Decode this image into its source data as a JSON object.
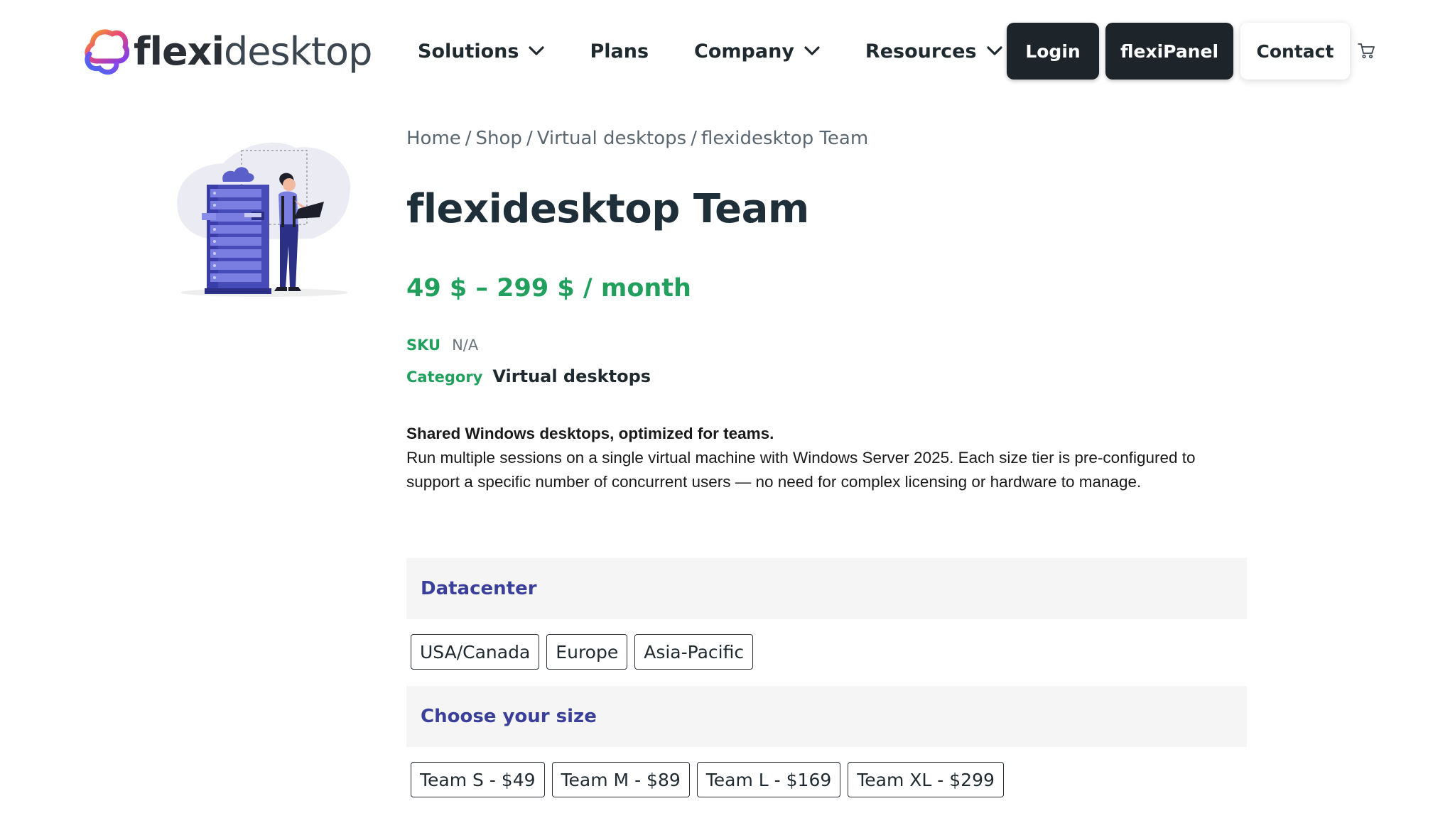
{
  "brand": {
    "logo_icon": "cloud-logo-icon",
    "name_bold": "flexi",
    "name_light": "desktop"
  },
  "nav": {
    "items": [
      {
        "label": "Solutions",
        "dropdown": true
      },
      {
        "label": "Plans",
        "dropdown": false
      },
      {
        "label": "Company",
        "dropdown": true
      },
      {
        "label": "Resources",
        "dropdown": true
      }
    ],
    "login": "Login",
    "panel": "flexiPanel",
    "contact": "Contact",
    "cart_icon": "cart-icon"
  },
  "breadcrumb": [
    "Home",
    "Shop",
    "Virtual desktops",
    "flexidesktop Team"
  ],
  "product": {
    "title": "flexidesktop Team",
    "price": "49 $ – 299 $ / month",
    "sku_label": "SKU",
    "sku_value": "N/A",
    "category_label": "Category",
    "category_value": "Virtual desktops",
    "desc_heading": "Shared Windows desktops, optimized for teams.",
    "desc_body": "Run multiple sessions on a single virtual machine with Windows Server 2025. Each size tier is pre-configured to support a specific number of concurrent users — no need for complex licensing or hardware to manage."
  },
  "datacenter": {
    "title": "Datacenter",
    "options": [
      "USA/Canada",
      "Europe",
      "Asia-Pacific"
    ]
  },
  "size": {
    "title": "Choose your size",
    "options": [
      "Team S - $49",
      "Team M - $89",
      "Team L - $169",
      "Team XL - $299"
    ]
  },
  "colors": {
    "accent_green": "#21a05d",
    "accent_purple": "#3a3f9a",
    "dark_button": "#1d252b"
  }
}
